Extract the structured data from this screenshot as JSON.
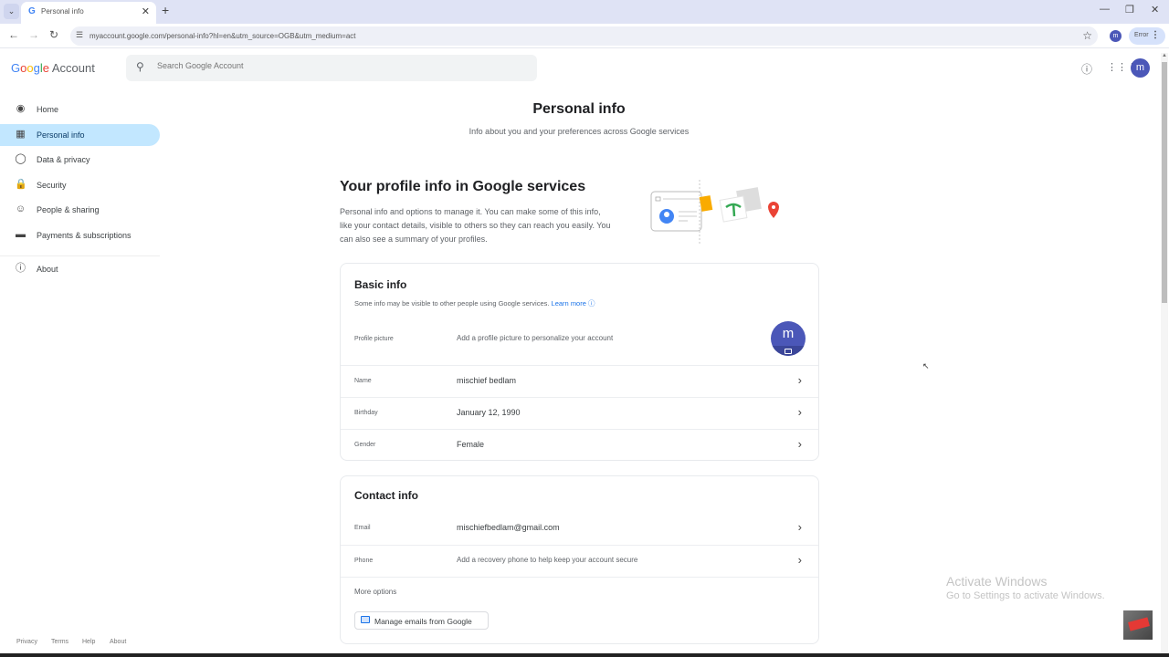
{
  "browser": {
    "tab_title": "Personal info",
    "url": "myaccount.google.com/personal-info?hl=en&utm_source=OGB&utm_medium=act",
    "profile_initial": "m",
    "error_label": "Error"
  },
  "header": {
    "logo_google": [
      "G",
      "o",
      "o",
      "g",
      "l",
      "e"
    ],
    "logo_account": "Account",
    "search_placeholder": "Search Google Account",
    "avatar_initial": "m"
  },
  "sidebar": {
    "items": [
      {
        "label": "Home",
        "icon": "account-circle-icon"
      },
      {
        "label": "Personal info",
        "icon": "id-card-icon",
        "active": true
      },
      {
        "label": "Data & privacy",
        "icon": "toggle-icon"
      },
      {
        "label": "Security",
        "icon": "lock-icon"
      },
      {
        "label": "People & sharing",
        "icon": "people-icon"
      },
      {
        "label": "Payments & subscriptions",
        "icon": "credit-card-icon"
      },
      {
        "label": "About",
        "icon": "info-icon"
      }
    ],
    "footer": [
      "Privacy",
      "Terms",
      "Help",
      "About"
    ]
  },
  "main": {
    "title": "Personal info",
    "subtitle": "Info about you and your preferences across Google services",
    "profile_section": {
      "title": "Your profile info in Google services",
      "description": "Personal info and options to manage it. You can make some of this info, like your contact details, visible to others so they can reach you easily. You can also see a summary of your profiles."
    },
    "basic_info": {
      "title": "Basic info",
      "note": "Some info may be visible to other people using Google services.",
      "learn_more": "Learn more",
      "profile_picture_label": "Profile picture",
      "profile_picture_hint": "Add a profile picture to personalize your account",
      "avatar_initial": "m",
      "rows": [
        {
          "key": "Name",
          "value": "mischief bedlam"
        },
        {
          "key": "Birthday",
          "value": "January 12, 1990"
        },
        {
          "key": "Gender",
          "value": "Female"
        }
      ]
    },
    "contact_info": {
      "title": "Contact info",
      "rows": [
        {
          "key": "Email",
          "value": "mischiefbedlam@gmail.com"
        },
        {
          "key": "Phone",
          "value": "Add a recovery phone to help keep your account secure"
        }
      ],
      "more_options": "More options",
      "manage_emails": "Manage emails from Google"
    }
  },
  "watermark": {
    "line1": "Activate Windows",
    "line2": "Go to Settings to activate Windows."
  },
  "colors": {
    "accent": "#1a73e8",
    "active_nav": "#c2e7ff",
    "avatar": "#4b57b8"
  }
}
